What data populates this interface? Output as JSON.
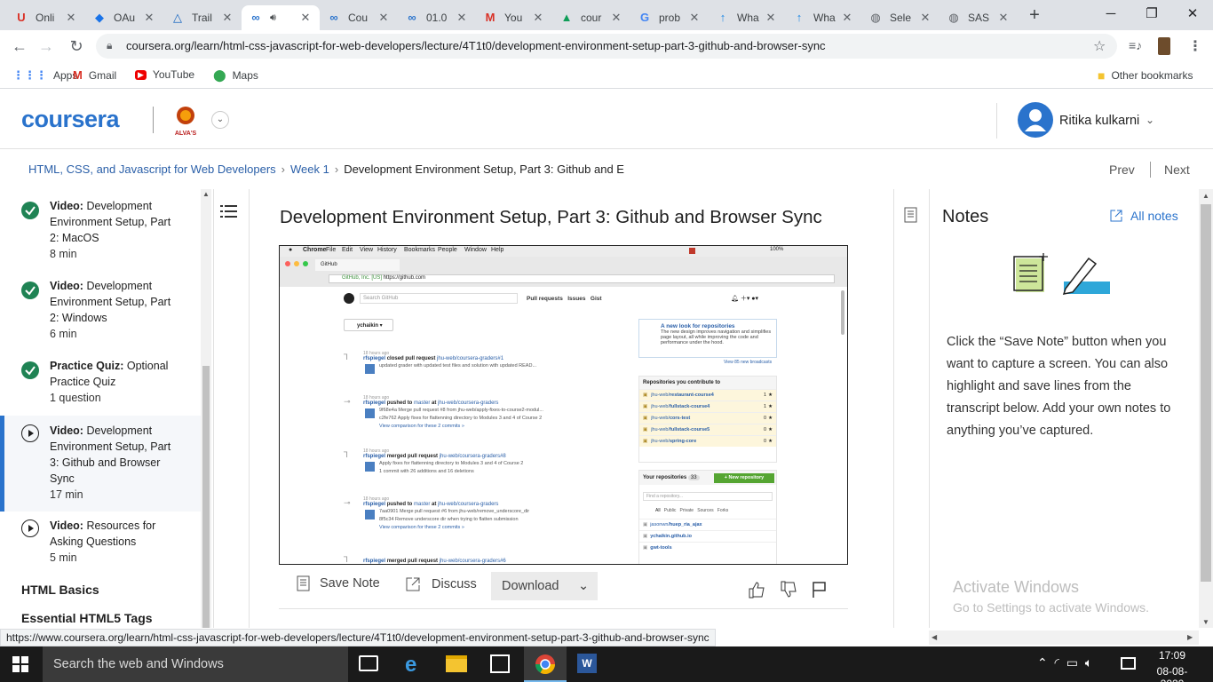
{
  "browser": {
    "tabs": [
      {
        "icon": "U",
        "title": "Onli",
        "color": "#d93025"
      },
      {
        "icon": "◆",
        "title": "OAu",
        "color": "#1a73e8"
      },
      {
        "icon": "△",
        "title": "Trail",
        "color": "#1565c0"
      },
      {
        "icon": "∞",
        "title": "",
        "color": "#2a73cc",
        "active": true
      },
      {
        "icon": "∞",
        "title": "Cou",
        "color": "#2a73cc"
      },
      {
        "icon": "∞",
        "title": "01.0",
        "color": "#2a73cc"
      },
      {
        "icon": "M",
        "title": "You",
        "color": "#d93025"
      },
      {
        "icon": "▲",
        "title": "cour",
        "color": "#0f9d58"
      },
      {
        "icon": "G",
        "title": "prob",
        "color": "#4285f4"
      },
      {
        "icon": "↑",
        "title": "Wha",
        "color": "#1e88e5"
      },
      {
        "icon": "↑",
        "title": "Wha",
        "color": "#1e88e5"
      },
      {
        "icon": "◍",
        "title": "Sele",
        "color": "#5f6368"
      },
      {
        "icon": "◍",
        "title": "SAS",
        "color": "#5f6368"
      }
    ],
    "url": "coursera.org/learn/html-css-javascript-for-web-developers/lecture/4T1t0/development-environment-setup-part-3-github-and-browser-sync",
    "bookmarks": [
      {
        "label": "Apps",
        "icon": "apps-grid-icon"
      },
      {
        "label": "Gmail",
        "icon": "gmail-icon"
      },
      {
        "label": "YouTube",
        "icon": "youtube-icon"
      },
      {
        "label": "Maps",
        "icon": "maps-icon"
      }
    ],
    "other_bookmarks": "Other bookmarks",
    "status_url": "https://www.coursera.org/learn/html-css-javascript-for-web-developers/lecture/4T1t0/development-environment-setup-part-3-github-and-browser-sync"
  },
  "header": {
    "logo": "coursera",
    "partner_logo": "ALVA'S",
    "user_name": "Ritika kulkarni"
  },
  "breadcrumb": {
    "course": "HTML, CSS, and Javascript for Web Developers",
    "week": "Week 1",
    "current": "Development Environment Setup, Part 3: Github and E",
    "prev": "Prev",
    "next": "Next"
  },
  "sidebar": {
    "items": [
      {
        "kind": "Video:",
        "title": "Development Environment Setup, Part 2: MacOS",
        "meta": "8 min",
        "status": "done"
      },
      {
        "kind": "Video:",
        "title": "Development Environment Setup, Part 2: Windows",
        "meta": "6 min",
        "status": "done"
      },
      {
        "kind": "Practice Quiz:",
        "title": "Optional Practice Quiz",
        "meta": "1 question",
        "status": "done"
      },
      {
        "kind": "Video:",
        "title": "Development Environment Setup, Part 3: Github and Browser Sync",
        "meta": "17 min",
        "status": "current"
      },
      {
        "kind": "Video:",
        "title": "Resources for Asking Questions",
        "meta": "5 min",
        "status": "todo"
      }
    ],
    "sections": [
      "HTML Basics",
      "Essential HTML5 Tags"
    ]
  },
  "lecture": {
    "title": "Development Environment Setup, Part 3: Github and Browser Sync",
    "actions": {
      "save_note": "Save Note",
      "discuss": "Discuss",
      "download": "Download"
    }
  },
  "video_frame": {
    "mac_menu": [
      "Chrome",
      "File",
      "Edit",
      "View",
      "History",
      "Bookmarks",
      "People",
      "Window",
      "Help"
    ],
    "mac_status": "100%",
    "tab_title": "GitHub",
    "address_secure": "GitHub, Inc. [US]",
    "address_url": "https://github.com",
    "search_placeholder": "Search GitHub",
    "gh_nav": [
      "Pull requests",
      "Issues",
      "Gist"
    ],
    "account": "ychaikin ▾",
    "feed": [
      {
        "time": "18 hours ago",
        "user": "rfspiegel",
        "action": "closed pull request",
        "target": "jhu-web/coursera-graders#1",
        "lines": [
          "updated grader with updated test files and solution with updated READ..."
        ]
      },
      {
        "time": "18 hours ago",
        "user": "rfspiegel",
        "action": "pushed to",
        "branch": "master",
        "at": "at",
        "target": "jhu-web/coursera-graders",
        "lines": [
          "9f68e4a Merge pull request #8 from jhu-web/apply-fixes-to-course2-modul...",
          "c2fe762 Apply fixes for flattenning directory to Modules 3 and 4 of Course 2",
          "View comparison for these 2 commits »"
        ]
      },
      {
        "time": "18 hours ago",
        "user": "rfspiegel",
        "action": "merged pull request",
        "target": "jhu-web/coursera-graders#8",
        "lines": [
          "Apply fixes for flattenning directory to Modules 3 and 4 of Course 2",
          "1 commit with 26 additions and 16 deletions"
        ]
      },
      {
        "time": "18 hours ago",
        "user": "rfspiegel",
        "action": "pushed to",
        "branch": "master",
        "at": "at",
        "target": "jhu-web/coursera-graders",
        "lines": [
          "7aa0901 Merge pull request #6 from jhu-web/remove_underscore_dir",
          "8f5c34 Remove underscore dir when trying to flatten submission",
          "View comparison for these 2 commits »"
        ]
      },
      {
        "time": "",
        "user": "rfspiegel",
        "action": "merged pull request",
        "target": "jhu-web/coursera-graders#6",
        "lines": []
      }
    ],
    "new_look": {
      "title": "A new look for repositories",
      "body": "The new design improves navigation and simplifies page layout, all while improving the code and performance under the hood.",
      "link": "View 85 new broadcasts"
    },
    "contrib_title": "Repositories you contribute to",
    "contrib": [
      {
        "org": "jhu-web/",
        "repo": "restaurant-course4",
        "stars": "1"
      },
      {
        "org": "jhu-web/",
        "repo": "fullstack-course4",
        "stars": "1"
      },
      {
        "org": "jhu-web/",
        "repo": "cors-test",
        "stars": "0"
      },
      {
        "org": "jhu-web/",
        "repo": "fullstack-course5",
        "stars": "0"
      },
      {
        "org": "jhu-web/",
        "repo": "spring-core",
        "stars": "0"
      }
    ],
    "your_repos_title": "Your repositories",
    "your_repos_count": "33",
    "new_repo": "+ New repository",
    "find_repo": "Find a repository...",
    "repo_filters": [
      "All",
      "Public",
      "Private",
      "Sources",
      "Forks"
    ],
    "your_repos": [
      {
        "org": "jasonwn/",
        "repo": "huep_ria_ajax"
      },
      {
        "org": "",
        "repo": "ychaikin.github.io"
      },
      {
        "org": "",
        "repo": "gwt-tools"
      }
    ]
  },
  "notes": {
    "heading": "Notes",
    "all_notes": "All notes",
    "body": "Click the “Save Note” button when you want to capture a screen. You can also highlight and save lines from the transcript below. Add your own notes to anything you’ve captured."
  },
  "watermark": {
    "line1": "Activate Windows",
    "line2": "Go to Settings to activate Windows."
  },
  "taskbar": {
    "search": "Search the web and Windows",
    "time": "17:09",
    "date": "08-08-2020"
  },
  "colors": {
    "brand": "#2a73cc",
    "done": "#1f8354",
    "tab_bar": "#dee1e6"
  }
}
